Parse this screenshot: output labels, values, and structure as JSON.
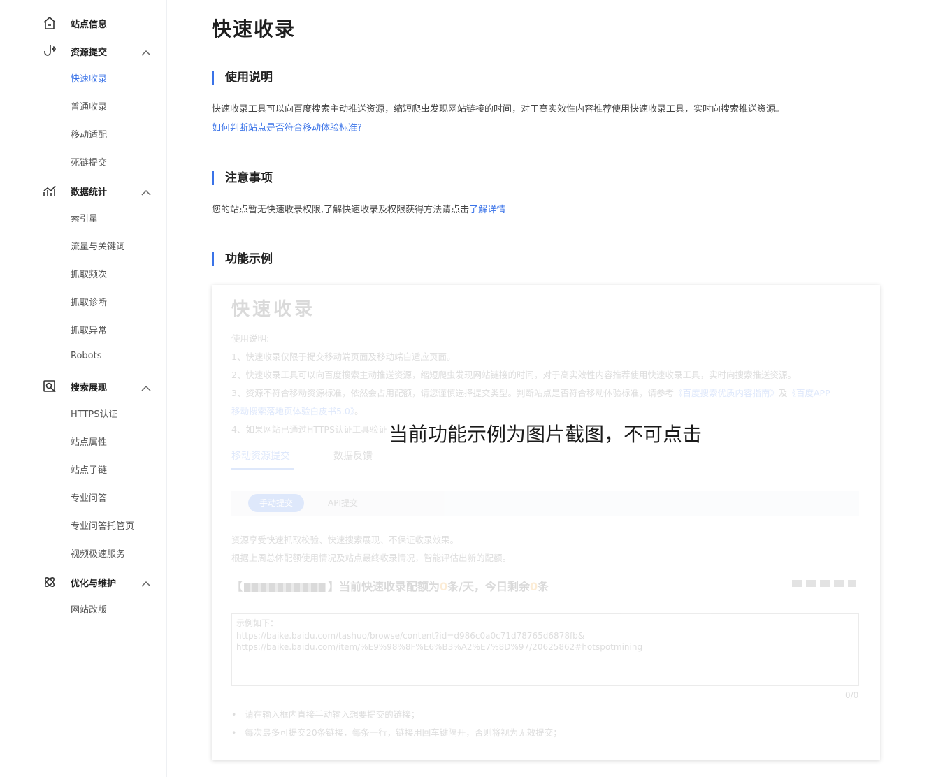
{
  "sidebar": {
    "groups": [
      {
        "label": "站点信息",
        "icon": "home-icon",
        "expandable": false,
        "items": []
      },
      {
        "label": "资源提交",
        "icon": "submit-hook-icon",
        "expandable": true,
        "items": [
          "快速收录",
          "普通收录",
          "移动适配",
          "死链提交"
        ]
      },
      {
        "label": "数据统计",
        "icon": "stats-icon",
        "expandable": true,
        "items": [
          "索引量",
          "流量与关键词",
          "抓取频次",
          "抓取诊断",
          "抓取异常",
          "Robots"
        ]
      },
      {
        "label": "搜索展现",
        "icon": "search-display-icon",
        "expandable": true,
        "items": [
          "HTTPS认证",
          "站点属性",
          "站点子链",
          "专业问答",
          "专业问答托管页",
          "视频极速服务"
        ]
      },
      {
        "label": "优化与维护",
        "icon": "optimize-icon",
        "expandable": true,
        "items": [
          "网站改版"
        ]
      }
    ],
    "active_item": "快速收录"
  },
  "main": {
    "title": "快速收录",
    "sections": {
      "usage": {
        "title": "使用说明",
        "text": "快速收录工具可以向百度搜索主动推送资源，缩短爬虫发现网站链接的时间，对于高实效性内容推荐使用快速收录工具，实时向搜索推送资源。",
        "link": "如何判断站点是否符合移动体验标准?"
      },
      "notice": {
        "title": "注意事项",
        "text": "您的站点暂无快速收录权限,了解快速收录及权限获得方法请点击",
        "link": "了解详情"
      },
      "example": {
        "title": "功能示例"
      }
    }
  },
  "example_image": {
    "title": "快速收录",
    "usage_label": "使用说明:",
    "lines": [
      "1、快速收录仅限于提交移动端页面及移动端自适应页面。",
      "2、快速收录工具可以向百度搜索主动推送资源，缩短爬虫发现网站链接的时间，对于高实效性内容推荐使用快速收录工具，实时向搜索推送资源。"
    ],
    "line3_prefix": "3、资源不符合移动资源标准，依然会占用配额，请您谨慎选择提交类型。判断站点是否符合移动体验标准，请参考",
    "line3_link1": "《百度搜索优质内容指南》",
    "line3_mid": "及",
    "line3_link2a": "《百度APP",
    "line3_link2b": "移动搜索落地页体验白皮书5.0》",
    "line3_suffix": "。",
    "line4": "4、如果网站已通过HTTPS认证工具验证",
    "tabs": [
      "移动资源提交",
      "数据反馈"
    ],
    "subtabs": [
      "手动提交",
      "API提交"
    ],
    "desc": [
      "资源享受快速抓取校验、快速搜索展现、不保证收录效果。",
      "根据上周总体配额使用情况及站点最终收录情况，智能评估出新的配额。"
    ],
    "quota_prefix": "【",
    "quota_mid": "】当前快速收录配额为",
    "quota_value": "0",
    "quota_unit": "条/天，今日剩余",
    "quota_remaining": "0",
    "quota_end": "条",
    "textarea_lines": [
      "示例如下：",
      "https://baike.baidu.com/tashuo/browse/content?id=d986c0a0c71d78765d6878fb&",
      "https://baike.baidu.com/item/%E9%98%8F%E6%B3%A2%E7%8D%97/20625862#hotspotmining"
    ],
    "counter": "0/0",
    "bullets": [
      "请在输入框内直接手动输入想要提交的链接；",
      "每次最多可提交20条链接，每条一行，链接用回车键隔开，否则将视为无效提交；"
    ],
    "overlay": "当前功能示例为图片截图，不可点击"
  }
}
